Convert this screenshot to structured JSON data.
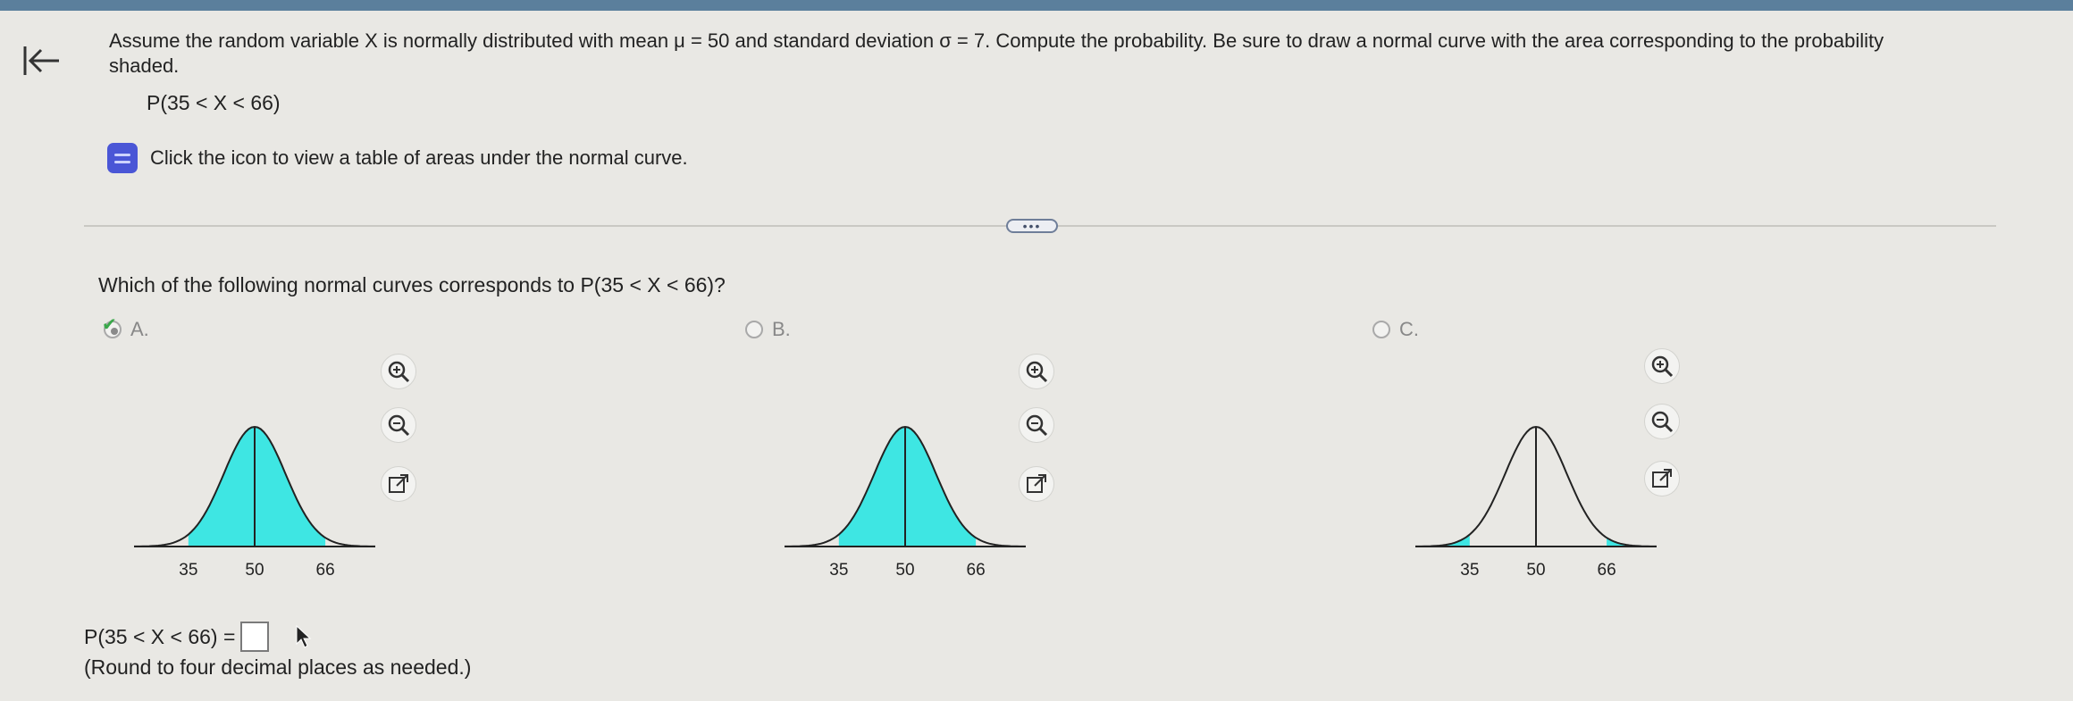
{
  "question": {
    "text": "Assume the random variable X is normally distributed with mean μ = 50 and standard deviation σ = 7. Compute the probability. Be sure to draw a normal curve with the area corresponding to the probability shaded.",
    "expression": "P(35 < X < 66)"
  },
  "table_link": {
    "label": "Click the icon to view a table of areas under the normal curve."
  },
  "more_button": {
    "label": "•••"
  },
  "choice_question": "Which of the following normal curves corresponds to P(35 < X < 66)?",
  "options": [
    {
      "letter": "A.",
      "selected": true,
      "ticks": [
        "35",
        "50",
        "66"
      ],
      "shading": "between"
    },
    {
      "letter": "B.",
      "selected": false,
      "ticks": [
        "35",
        "50",
        "66"
      ],
      "shading": "between"
    },
    {
      "letter": "C.",
      "selected": false,
      "ticks": [
        "35",
        "50",
        "66"
      ],
      "shading": "tails"
    }
  ],
  "answer": {
    "label": "P(35 < X < 66) =",
    "value": "",
    "note": "(Round to four decimal places as needed.)"
  },
  "colors": {
    "shade": "#3ee6e3",
    "accent": "#4a56d6"
  }
}
